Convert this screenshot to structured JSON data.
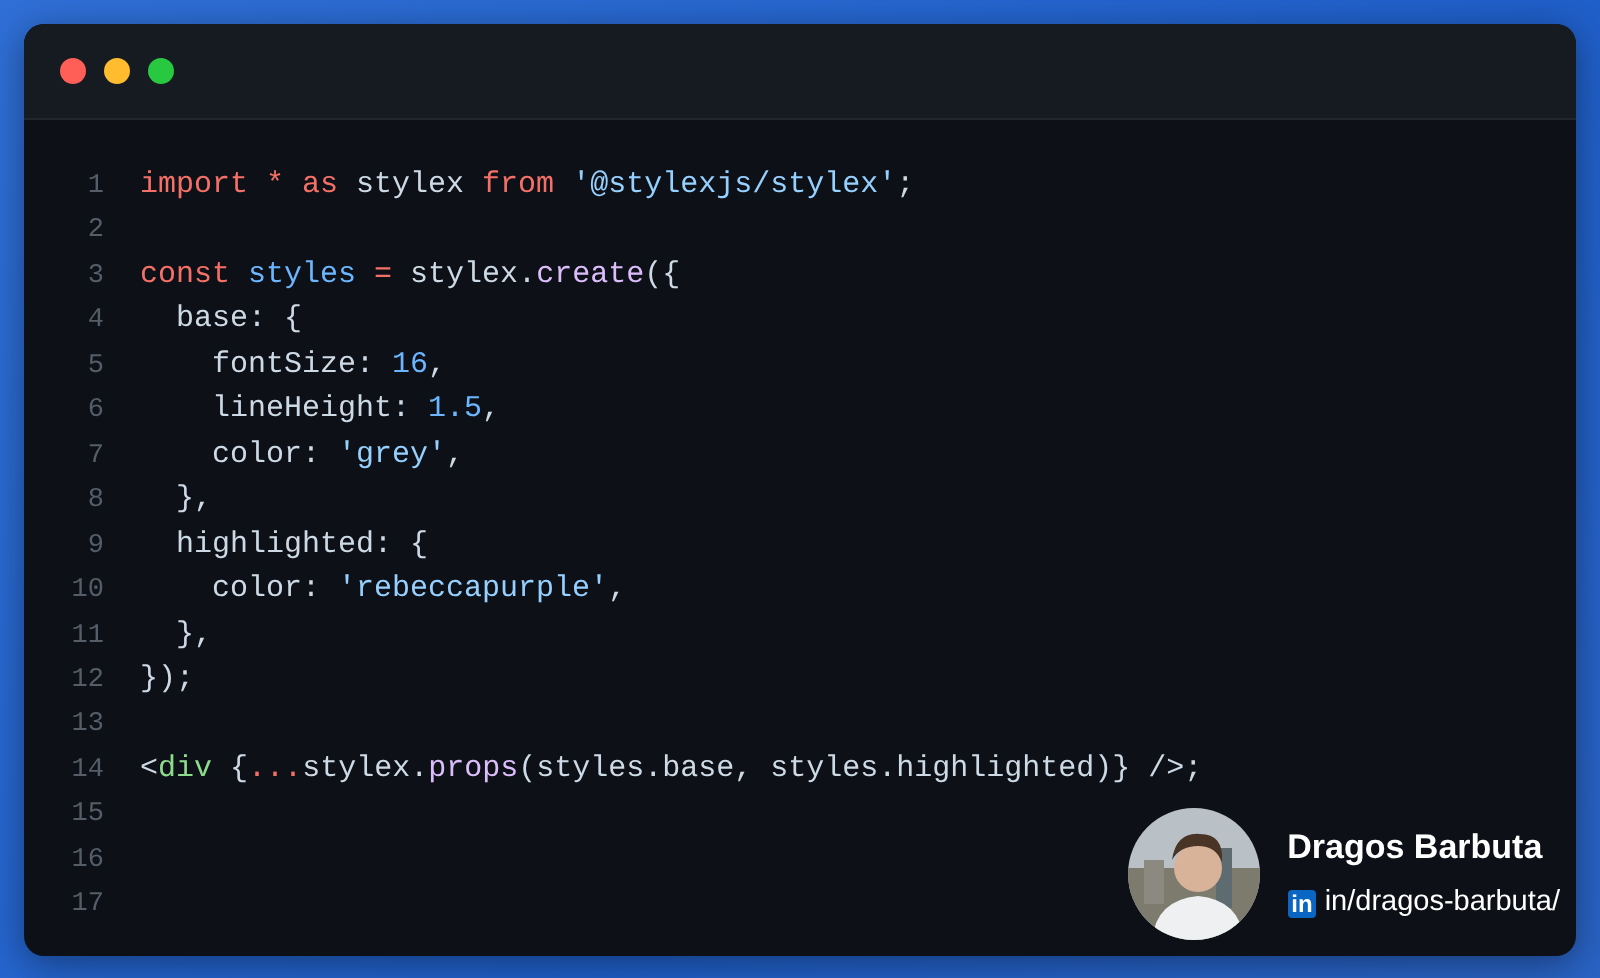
{
  "window": {
    "controls": [
      {
        "color": "#ff5f57"
      },
      {
        "color": "#febc2e"
      },
      {
        "color": "#28c840"
      }
    ]
  },
  "code": {
    "lines": [
      {
        "number": "1",
        "tokens": [
          {
            "kind": "keyword",
            "text": "import * as"
          },
          {
            "kind": "plain",
            "text": " stylex "
          },
          {
            "kind": "keyword",
            "text": "from"
          },
          {
            "kind": "string",
            "text": " '@stylexjs/stylex'"
          },
          {
            "kind": "plain",
            "text": ";"
          }
        ]
      },
      {
        "number": "2"
      },
      {
        "number": "3",
        "tokens": [
          {
            "kind": "keyword",
            "text": "const"
          },
          {
            "kind": "variable",
            "text": " styles"
          },
          {
            "kind": "keyword",
            "text": " ="
          },
          {
            "kind": "plain",
            "text": " stylex."
          },
          {
            "kind": "function",
            "text": "create"
          },
          {
            "kind": "plain",
            "text": "({"
          }
        ]
      },
      {
        "number": "4",
        "tokens": [
          {
            "kind": "plain",
            "text": "  base: {"
          }
        ]
      },
      {
        "number": "5",
        "tokens": [
          {
            "kind": "plain",
            "text": "    fontSize: "
          },
          {
            "kind": "number",
            "text": "16"
          },
          {
            "kind": "plain",
            "text": ","
          }
        ]
      },
      {
        "number": "6",
        "tokens": [
          {
            "kind": "plain",
            "text": "    lineHeight: "
          },
          {
            "kind": "number",
            "text": "1.5"
          },
          {
            "kind": "plain",
            "text": ","
          }
        ]
      },
      {
        "number": "7",
        "tokens": [
          {
            "kind": "plain",
            "text": "    color: "
          },
          {
            "kind": "string",
            "text": "'grey'"
          },
          {
            "kind": "plain",
            "text": ","
          }
        ]
      },
      {
        "number": "8",
        "tokens": [
          {
            "kind": "plain",
            "text": "  },"
          }
        ]
      },
      {
        "number": "9",
        "tokens": [
          {
            "kind": "plain",
            "text": "  highlighted: {"
          }
        ]
      },
      {
        "number": "10",
        "tokens": [
          {
            "kind": "plain",
            "text": "    color: "
          },
          {
            "kind": "string",
            "text": "'rebeccapurple'"
          },
          {
            "kind": "plain",
            "text": ","
          }
        ]
      },
      {
        "number": "11",
        "tokens": [
          {
            "kind": "plain",
            "text": "  },"
          }
        ]
      },
      {
        "number": "12",
        "tokens": [
          {
            "kind": "plain",
            "text": "});"
          }
        ]
      },
      {
        "number": "13"
      },
      {
        "number": "14",
        "tokens": [
          {
            "kind": "plain",
            "text": "<"
          },
          {
            "kind": "tag",
            "text": "div"
          },
          {
            "kind": "plain",
            "text": " {"
          },
          {
            "kind": "keyword",
            "text": "..."
          },
          {
            "kind": "plain",
            "text": "stylex."
          },
          {
            "kind": "function",
            "text": "props"
          },
          {
            "kind": "plain",
            "text": "(styles.base, styles.highlighted)} />;"
          }
        ]
      },
      {
        "number": "15"
      },
      {
        "number": "16"
      },
      {
        "number": "17"
      }
    ]
  },
  "author": {
    "name": "Dragos Barbuta",
    "linkedin_badge": "in",
    "profile": "in/dragos-barbuta/"
  }
}
